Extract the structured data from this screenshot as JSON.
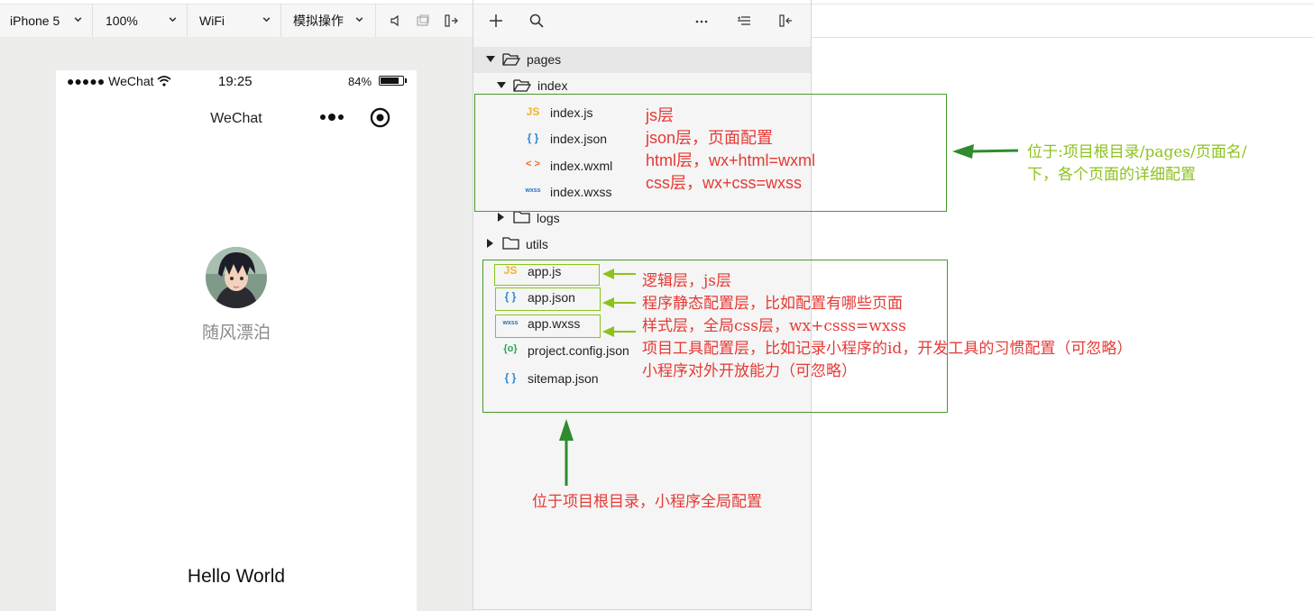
{
  "toolbar": {
    "device": "iPhone 5",
    "zoom": "100%",
    "network": "WiFi",
    "operation": "模拟操作"
  },
  "phone": {
    "carrier": "●●●●● WeChat",
    "time": "19:25",
    "battery": "84%",
    "battery_level": 0.84,
    "nav_title": "WeChat",
    "nickname": "随风漂泊",
    "body_text": "Hello World"
  },
  "tree": {
    "pages": "pages",
    "index": "index",
    "index_files": [
      {
        "icon": "JS",
        "name": "index.js"
      },
      {
        "icon": "{ }",
        "name": "index.json"
      },
      {
        "icon": "< >",
        "name": "index.wxml"
      },
      {
        "icon": "wxss",
        "name": "index.wxss"
      }
    ],
    "logs": "logs",
    "utils": "utils",
    "root_files": [
      {
        "icon": "JS",
        "name": "app.js"
      },
      {
        "icon": "{ }",
        "name": "app.json"
      },
      {
        "icon": "wxss",
        "name": "app.wxss"
      },
      {
        "icon": "{o}",
        "name": "project.config.json"
      },
      {
        "icon": "{ }",
        "name": "sitemap.json"
      }
    ]
  },
  "annotations": {
    "index_notes": [
      "js层",
      "json层，页面配置",
      "html层，wx+html=wxml",
      "css层，wx+css=wxss"
    ],
    "page_location": [
      "位于:项目根目录/pages/页面名/",
      "下，各个页面的详细配置"
    ],
    "root_notes": [
      "逻辑层，js层",
      "程序静态配置层，比如配置有哪些页面",
      "样式层，全局css层，wx+csss=wxss",
      "项目工具配置层，比如记录小程序的id，开发工具的习惯配置（可忽略）",
      "小程序对外开放能力（可忽略）"
    ],
    "root_location": "位于项目根目录，小程序全局配置"
  },
  "colors": {
    "annotation_red": "#e53935",
    "annotation_green": "#8cc21e",
    "box_green": "#4a9a2a",
    "arrow_dark_green": "#2e8b2e"
  },
  "icons": [
    "chevron-down-icon",
    "volume-icon",
    "window-icon",
    "dock-icon",
    "plus-icon",
    "search-icon",
    "more-icon",
    "collapse-icon",
    "dock-left-icon",
    "folder-open-icon",
    "folder-icon",
    "wifi-icon",
    "battery-icon",
    "more-dots-icon",
    "record-icon"
  ]
}
